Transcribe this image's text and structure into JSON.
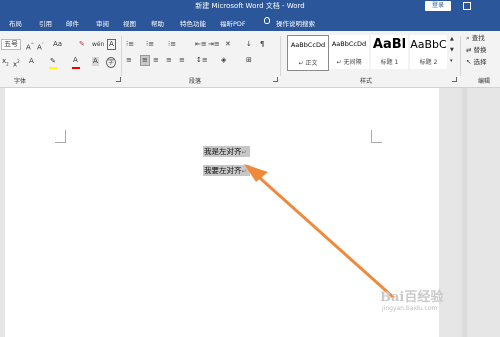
{
  "window": {
    "title": "新建 Microsoft Word 文档 - Word",
    "login_label": "登录"
  },
  "tabs": [
    "布局",
    "引用",
    "邮件",
    "审阅",
    "视图",
    "帮助",
    "特色功能",
    "福昕PDF",
    "操作说明搜索"
  ],
  "ribbon": {
    "font_size_partial": "五号",
    "font_controls": [
      "A^",
      "A˅",
      "Aa",
      "A",
      "A"
    ],
    "group_font": "字体",
    "group_paragraph": "段落",
    "group_styles": "样式",
    "group_editing": "编辑",
    "styles": [
      {
        "preview": "AaBbCcDd",
        "label": "↵ 正文"
      },
      {
        "preview": "AaBbCcDd",
        "label": "↵ 无间隔"
      },
      {
        "preview": "AaBl",
        "label": "标题 1"
      },
      {
        "preview": "AaBbC",
        "label": "标题 2"
      }
    ],
    "editing": [
      {
        "icon": "search-icon",
        "label": "查找"
      },
      {
        "icon": "replace-icon",
        "label": "替换"
      },
      {
        "icon": "select-icon",
        "label": "选择"
      }
    ]
  },
  "document": {
    "lines": [
      "我是左对齐",
      "我要左对齐"
    ],
    "paragraph_mark": "↵",
    "selection_color": "#c7c7c7"
  },
  "annotation": {
    "arrow_color": "#ef8a3c"
  },
  "watermark": {
    "brand": "Bai百经验",
    "url": "jingyan.baidu.com"
  },
  "colors": {
    "accent": "#2b579a",
    "ribbon_bg": "#f3f3f3",
    "canvas_bg": "#e6e6e6"
  }
}
